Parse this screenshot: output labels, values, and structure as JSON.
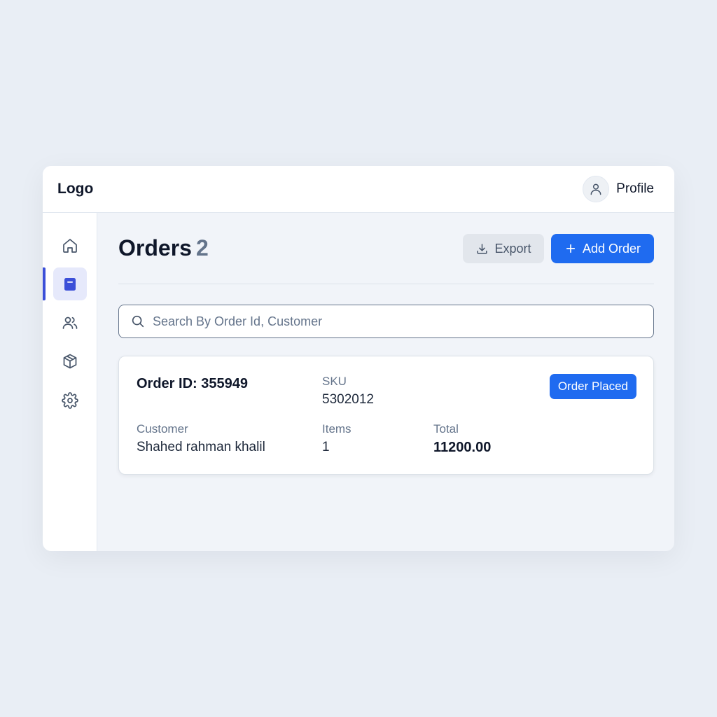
{
  "header": {
    "logo": "Logo",
    "profile_label": "Profile"
  },
  "sidebar": {
    "items": [
      {
        "name": "home",
        "icon": "home-icon",
        "active": false
      },
      {
        "name": "orders",
        "icon": "orders-icon",
        "active": true
      },
      {
        "name": "customers",
        "icon": "users-icon",
        "active": false
      },
      {
        "name": "products",
        "icon": "box-icon",
        "active": false
      },
      {
        "name": "settings",
        "icon": "gear-icon",
        "active": false
      }
    ]
  },
  "page": {
    "title": "Orders",
    "count": "2",
    "export_label": "Export",
    "add_label": "Add Order"
  },
  "search": {
    "placeholder": "Search By Order Id, Customer",
    "value": ""
  },
  "orders": [
    {
      "order_id_label": "Order ID: 355949",
      "sku_label": "SKU",
      "sku": "5302012",
      "status": "Order Placed",
      "customer_label": "Customer",
      "customer": "Shahed rahman khalil",
      "items_label": "Items",
      "items": "1",
      "total_label": "Total",
      "total": "11200.00"
    }
  ],
  "colors": {
    "accent": "#1f6bf0",
    "active_nav": "#3b4fd8",
    "active_nav_bg": "#e6e9fb",
    "background": "#e9eef5"
  }
}
